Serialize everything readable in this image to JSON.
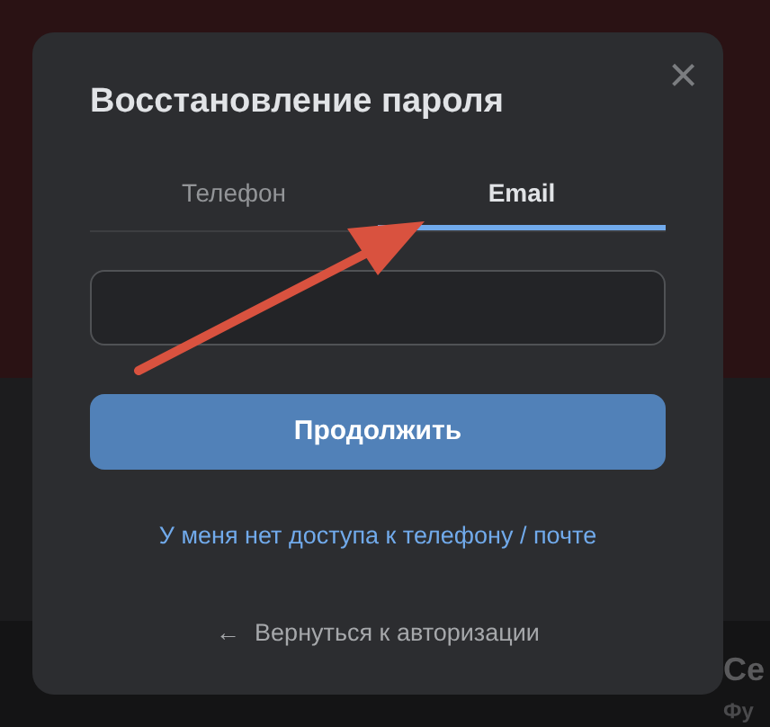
{
  "background": {
    "cards": [
      {
        "title": "Се",
        "subtitle": "Фу"
      }
    ]
  },
  "dialog": {
    "title": "Восстановление пароля",
    "close": "×",
    "tabs": [
      {
        "label": "Телефон",
        "selected": false
      },
      {
        "label": "Email",
        "selected": true
      }
    ],
    "email_field": {
      "kind": "input"
    },
    "continue_button": "Продолжить",
    "no_access_link": "У меня нет доступа к телефону / почте",
    "back_link": {
      "icon": "←",
      "label": "Вернуться к авторизации"
    }
  },
  "annotation": {
    "kind": "arrow"
  }
}
